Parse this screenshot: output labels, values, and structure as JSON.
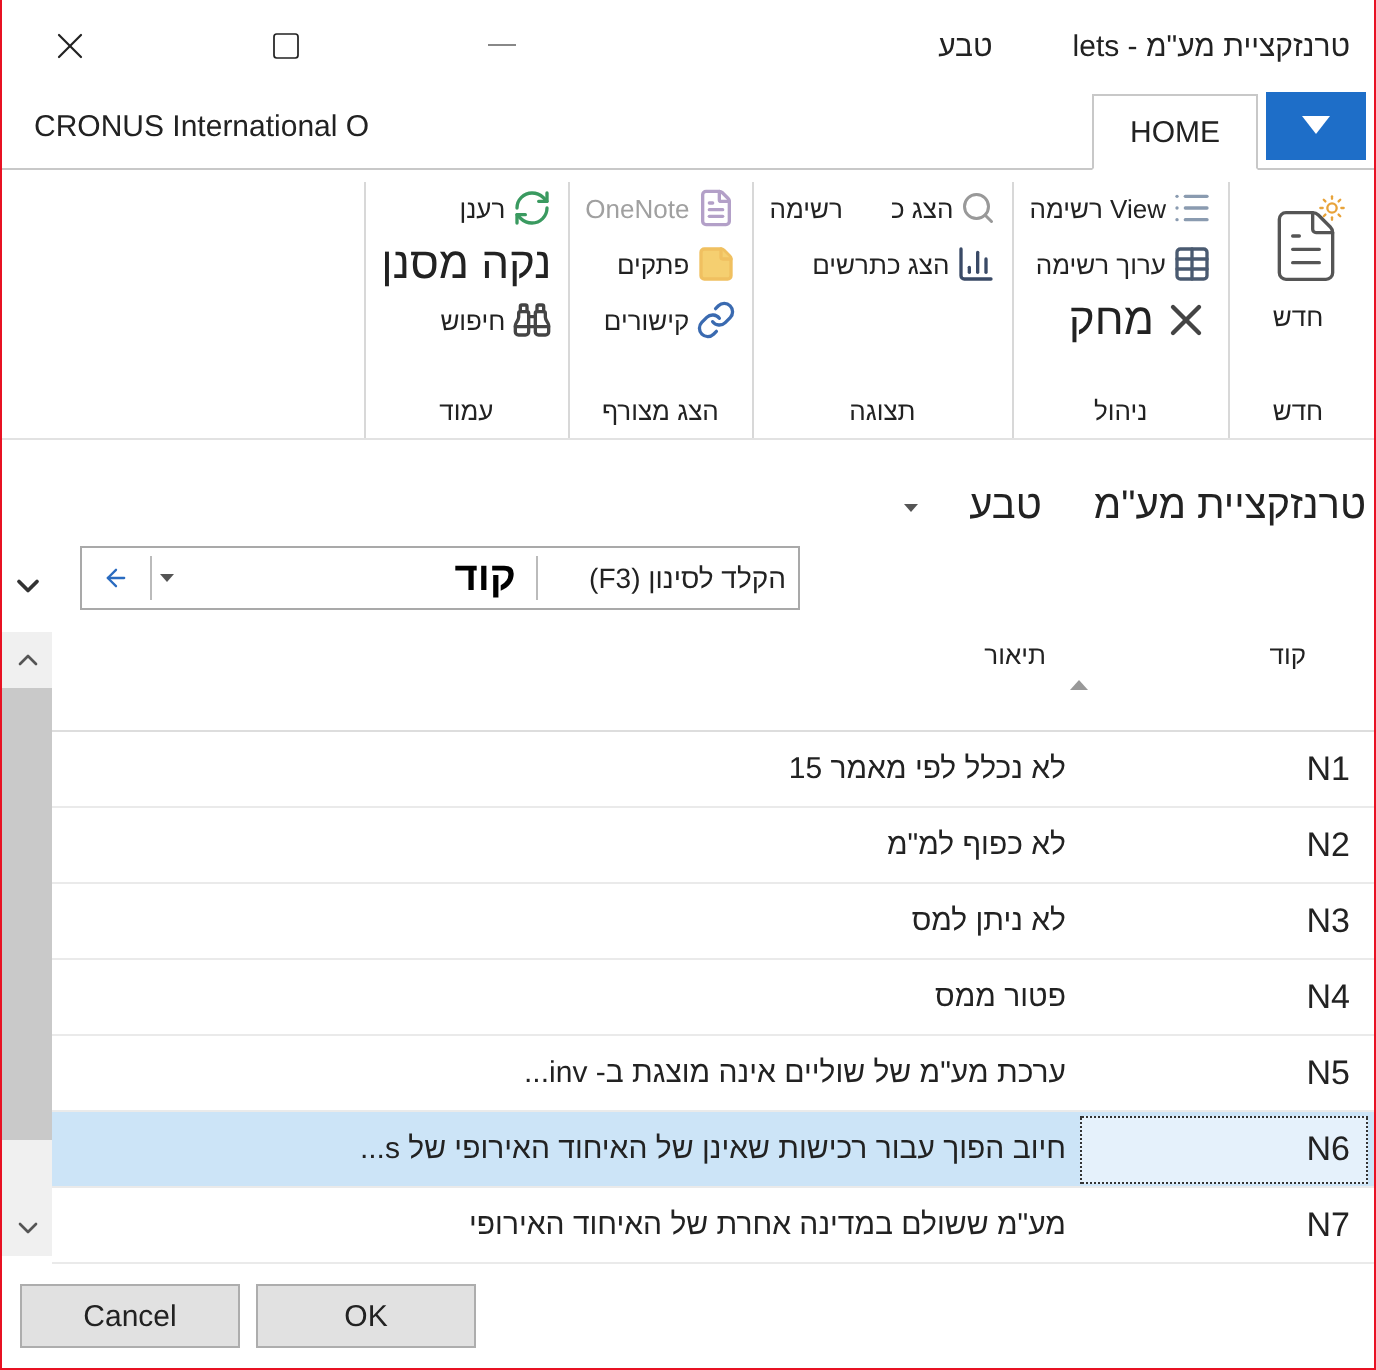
{
  "window": {
    "title": "טרנזקציית מע\"מ - lets",
    "subtitle": "טבע"
  },
  "ribbon_tabs": {
    "company": "CRONUS International O",
    "tabs": [
      {
        "label": "HOME",
        "selected": true
      }
    ]
  },
  "ribbon": {
    "groups": [
      {
        "label": "חדש",
        "rows": [
          [
            {
              "kind": "large",
              "label": "חדש",
              "disabled": false
            }
          ]
        ]
      },
      {
        "label": "ניהול",
        "rows": [
          [
            {
              "kind": "small",
              "label": "View רשימה",
              "disabled": false
            }
          ],
          [
            {
              "kind": "small",
              "label": "ערוך רשימה",
              "disabled": false
            }
          ],
          [
            {
              "kind": "big-text",
              "label": "מחק",
              "disabled": false
            }
          ]
        ]
      },
      {
        "label": "תצוגה",
        "rows": [
          [
            {
              "kind": "small",
              "label": "הצג כ",
              "disabled": false
            },
            {
              "kind": "text",
              "label": "רשימה",
              "disabled": false
            }
          ],
          [
            {
              "kind": "small",
              "label": "הצג כתרשים",
              "disabled": false
            }
          ]
        ]
      },
      {
        "label": "הצג מצורף",
        "rows": [
          [
            {
              "kind": "small",
              "label": "OneNote",
              "disabled": true
            }
          ],
          [
            {
              "kind": "small",
              "label": "פתקים",
              "disabled": false
            }
          ],
          [
            {
              "kind": "small",
              "label": "קישורים",
              "disabled": false
            }
          ]
        ]
      },
      {
        "label": "עמוד",
        "rows": [
          [
            {
              "kind": "small",
              "label": "רענן",
              "disabled": false
            }
          ],
          [
            {
              "kind": "big-text",
              "label": "נקה מסנן",
              "disabled": false
            }
          ],
          [
            {
              "kind": "small",
              "label": "חיפוש",
              "disabled": false
            }
          ]
        ]
      }
    ]
  },
  "page": {
    "title": "טרנזקציית מע\"מ",
    "company": "טבע"
  },
  "filter": {
    "placeholder": "הקלד לסינון (F3)",
    "field": "קוד"
  },
  "table": {
    "columns": [
      {
        "label": "קוד",
        "sorted": false
      },
      {
        "label": "תיאור",
        "sorted": true
      }
    ],
    "rows": [
      {
        "code": "N1",
        "description": "לא נכלל לפי  מאמר 15",
        "selected": false
      },
      {
        "code": "N2",
        "description": "לא כפוף למ\"מ",
        "selected": false
      },
      {
        "code": "N3",
        "description": "לא ניתן למס",
        "selected": false
      },
      {
        "code": "N4",
        "description": "פטור ממס",
        "selected": false
      },
      {
        "code": "N5",
        "description": "ערכת מע\"מ של שוליים אינה מוצגת ב- inv...",
        "selected": false
      },
      {
        "code": "N6",
        "description": "חיוב הפוך עבור רכישות שאינן של האיחוד האירופי של s...",
        "selected": true
      },
      {
        "code": "N7",
        "description": "מע\"מ ששולם במדינה אחרת של האיחוד האירופי",
        "selected": false
      }
    ]
  },
  "buttons": [
    {
      "label": "OK"
    },
    {
      "label": "Cancel"
    }
  ]
}
